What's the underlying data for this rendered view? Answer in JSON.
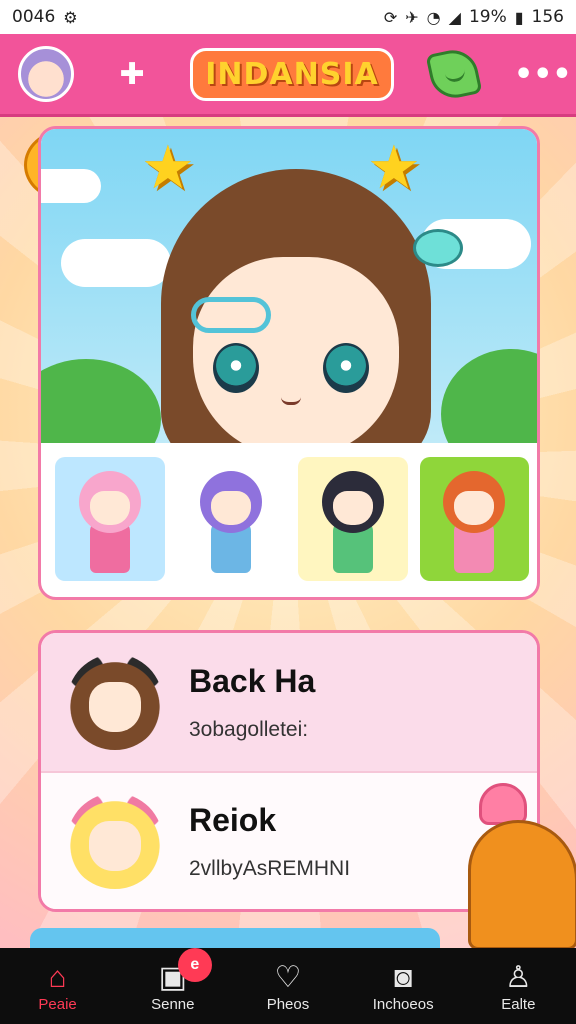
{
  "status_bar": {
    "time": "0046",
    "battery_percent": "19%",
    "battery_level": "156",
    "icons": [
      "sync-icon",
      "settings-icon",
      "wifi-icon",
      "signal-icon",
      "battery-icon"
    ]
  },
  "header": {
    "brand": "INDANSIA",
    "add_glyph": "✚",
    "more_glyph": "•••"
  },
  "thumbnails": [
    {
      "name": "pink-haired-character",
      "bg": "#bde7ff",
      "hair": "#f8a6cc",
      "outfit": "#ef6da0"
    },
    {
      "name": "purple-haired-character",
      "bg": "#ffffff",
      "hair": "#8f72dd",
      "outfit": "#6cb6e5"
    },
    {
      "name": "black-haired-character",
      "bg": "#fff6c0",
      "hair": "#2c2c3a",
      "outfit": "#56c27a"
    },
    {
      "name": "orange-haired-character",
      "bg": "#8fd63a",
      "hair": "#e4672e",
      "outfit": "#f38ab3"
    }
  ],
  "list": [
    {
      "title": "Back Ha",
      "subtitle": "3obagolletei:",
      "hair": "#7a4a2a",
      "accent": "#2b2b2b"
    },
    {
      "title": "Reiok",
      "subtitle": "2vllbyAsREMHNI",
      "hair": "#ffe066",
      "accent": "#f07aa2"
    }
  ],
  "bottom_nav": [
    {
      "label": "Peaie",
      "glyph": "⌂",
      "active": true
    },
    {
      "label": "Senne",
      "glyph": "▣",
      "badge": "e"
    },
    {
      "label": "Pheos",
      "glyph": "♡"
    },
    {
      "label": "Inchoeos",
      "glyph": "◙"
    },
    {
      "label": "Ealte",
      "glyph": "♙"
    }
  ],
  "colors": {
    "header": "#f2549a",
    "accent": "#ff3a55",
    "card_border": "#f27aa8"
  }
}
